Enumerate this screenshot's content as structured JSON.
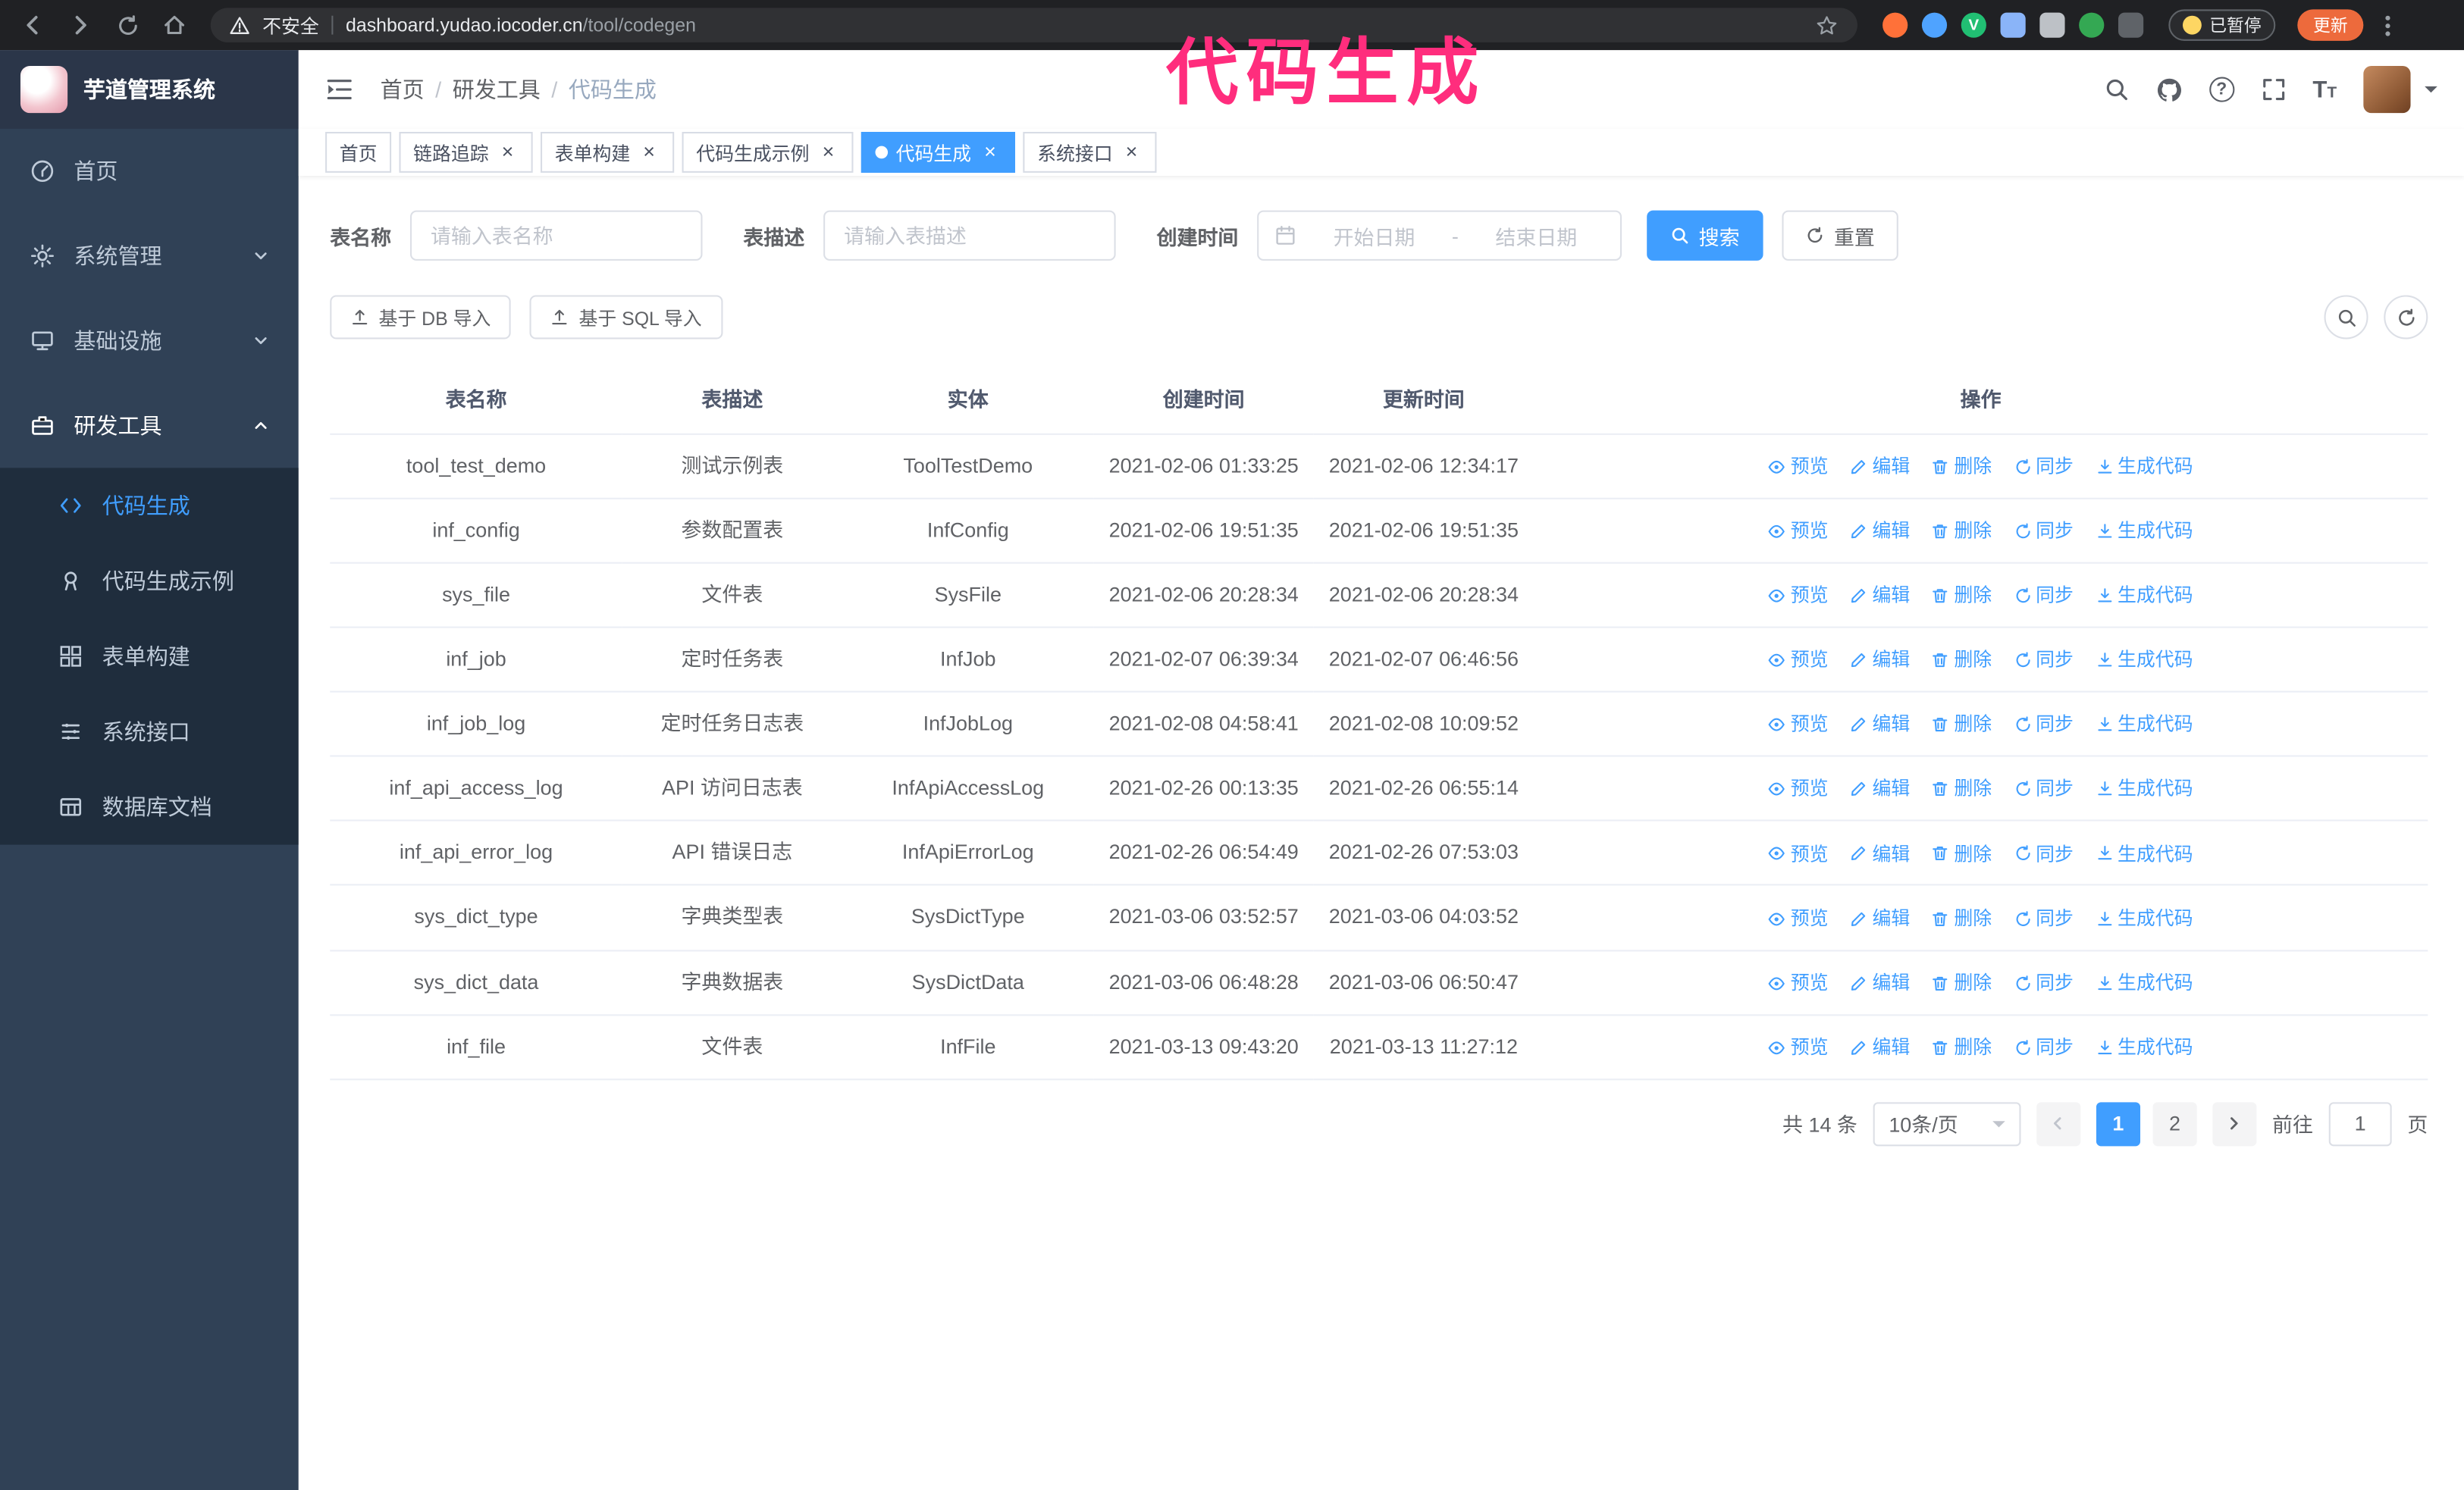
{
  "colors": {
    "accent": "#409eff",
    "sidebar_bg": "#304156",
    "submenu_bg": "#1f2d3d",
    "annotation_pink": "#ff2d7d",
    "update_button_bg": "#ed6a3c"
  },
  "browser": {
    "security_label": "不安全",
    "url_host": "dashboard.yudao.iocoder.cn",
    "url_path": "/tool/codegen",
    "paused_badge": "已暂停",
    "update_button": "更新"
  },
  "annotation": {
    "text": "代码生成",
    "color": "#ff2d7d"
  },
  "sidebar": {
    "title": "芋道管理系统",
    "items": [
      {
        "label": "首页"
      },
      {
        "label": "系统管理"
      },
      {
        "label": "基础设施"
      },
      {
        "label": "研发工具"
      }
    ],
    "sub_items": [
      {
        "label": "代码生成"
      },
      {
        "label": "代码生成示例"
      },
      {
        "label": "表单构建"
      },
      {
        "label": "系统接口"
      },
      {
        "label": "数据库文档"
      }
    ]
  },
  "breadcrumb": {
    "items": [
      "首页",
      "研发工具",
      "代码生成"
    ],
    "separator": "/"
  },
  "tabs": [
    {
      "label": "首页",
      "closable": false,
      "active": false
    },
    {
      "label": "链路追踪",
      "closable": true,
      "active": false
    },
    {
      "label": "表单构建",
      "closable": true,
      "active": false
    },
    {
      "label": "代码生成示例",
      "closable": true,
      "active": false
    },
    {
      "label": "代码生成",
      "closable": true,
      "active": true
    },
    {
      "label": "系统接口",
      "closable": true,
      "active": false
    }
  ],
  "filters": {
    "name_label": "表名称",
    "name_placeholder": "请输入表名称",
    "desc_label": "表描述",
    "desc_placeholder": "请输入表描述",
    "time_label": "创建时间",
    "start_placeholder": "开始日期",
    "range_separator": "-",
    "end_placeholder": "结束日期",
    "search_button": "搜索",
    "reset_button": "重置"
  },
  "toolbar": {
    "import_db_button": "基于 DB 导入",
    "import_sql_button": "基于 SQL 导入"
  },
  "table": {
    "columns": [
      "表名称",
      "表描述",
      "实体",
      "创建时间",
      "更新时间",
      "操作"
    ],
    "actions": [
      "预览",
      "编辑",
      "删除",
      "同步",
      "生成代码"
    ],
    "rows": [
      {
        "name": "tool_test_demo",
        "desc": "测试示例表",
        "entity": "ToolTestDemo",
        "created": "2021-02-06 01:33:25",
        "updated": "2021-02-06 12:34:17"
      },
      {
        "name": "inf_config",
        "desc": "参数配置表",
        "entity": "InfConfig",
        "created": "2021-02-06 19:51:35",
        "updated": "2021-02-06 19:51:35"
      },
      {
        "name": "sys_file",
        "desc": "文件表",
        "entity": "SysFile",
        "created": "2021-02-06 20:28:34",
        "updated": "2021-02-06 20:28:34"
      },
      {
        "name": "inf_job",
        "desc": "定时任务表",
        "entity": "InfJob",
        "created": "2021-02-07 06:39:34",
        "updated": "2021-02-07 06:46:56"
      },
      {
        "name": "inf_job_log",
        "desc": "定时任务日志表",
        "entity": "InfJobLog",
        "created": "2021-02-08 04:58:41",
        "updated": "2021-02-08 10:09:52"
      },
      {
        "name": "inf_api_access_log",
        "desc": "API 访问日志表",
        "entity": "InfApiAccessLog",
        "created": "2021-02-26 00:13:35",
        "updated": "2021-02-26 06:55:14"
      },
      {
        "name": "inf_api_error_log",
        "desc": "API 错误日志",
        "entity": "InfApiErrorLog",
        "created": "2021-02-26 06:54:49",
        "updated": "2021-02-26 07:53:03"
      },
      {
        "name": "sys_dict_type",
        "desc": "字典类型表",
        "entity": "SysDictType",
        "created": "2021-03-06 03:52:57",
        "updated": "2021-03-06 04:03:52"
      },
      {
        "name": "sys_dict_data",
        "desc": "字典数据表",
        "entity": "SysDictData",
        "created": "2021-03-06 06:48:28",
        "updated": "2021-03-06 06:50:47"
      },
      {
        "name": "inf_file",
        "desc": "文件表",
        "entity": "InfFile",
        "created": "2021-03-13 09:43:20",
        "updated": "2021-03-13 11:27:12"
      }
    ]
  },
  "pagination": {
    "total_text": "共 14 条",
    "page_size": "10条/页",
    "pages": [
      "1",
      "2"
    ],
    "active_page": "1",
    "goto_label": "前往",
    "goto_value": "1",
    "unit_label": "页"
  }
}
